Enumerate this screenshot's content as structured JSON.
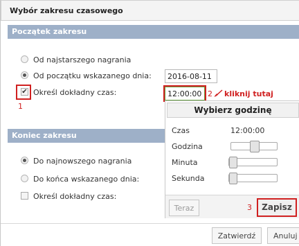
{
  "dialog": {
    "title": "Wybór zakresu czasowego"
  },
  "start": {
    "header": "Początek zakresu",
    "opt_oldest": "Od najstarszego nagrania",
    "opt_from_day": "Od początku wskazanego dnia:",
    "date_value": "2016-08-11",
    "exact_time_label": "Określ dokładny czas:",
    "exact_time_checked": true,
    "time_value": "12:00:00",
    "selected": "opt_from_day"
  },
  "end": {
    "header": "Koniec zakresu",
    "opt_newest": "Do najnowszego nagrania",
    "opt_to_day": "Do końca wskazanego dnia:",
    "exact_time_label": "Określ dokładny czas:",
    "exact_time_checked": false,
    "selected": "opt_newest"
  },
  "annotations": {
    "step1": "1",
    "step2": "2",
    "step2_text": "kliknij tutaj",
    "step3": "3",
    "color": "#d02020"
  },
  "time_picker": {
    "title": "Wybierz godzinę",
    "time_label": "Czas",
    "time_value": "12:00:00",
    "hour_label": "Godzina",
    "minute_label": "Minuta",
    "second_label": "Sekunda",
    "hour_value": 12,
    "minute_value": 0,
    "second_value": 0,
    "now_button": "Teraz",
    "save_button": "Zapisz"
  },
  "footer": {
    "confirm_button": "Zatwierdź",
    "cancel_button": "Anuluj"
  },
  "colors": {
    "section_header": "#9eb0c8",
    "accent_red": "#d02020",
    "input_focus": "#6aa344"
  }
}
